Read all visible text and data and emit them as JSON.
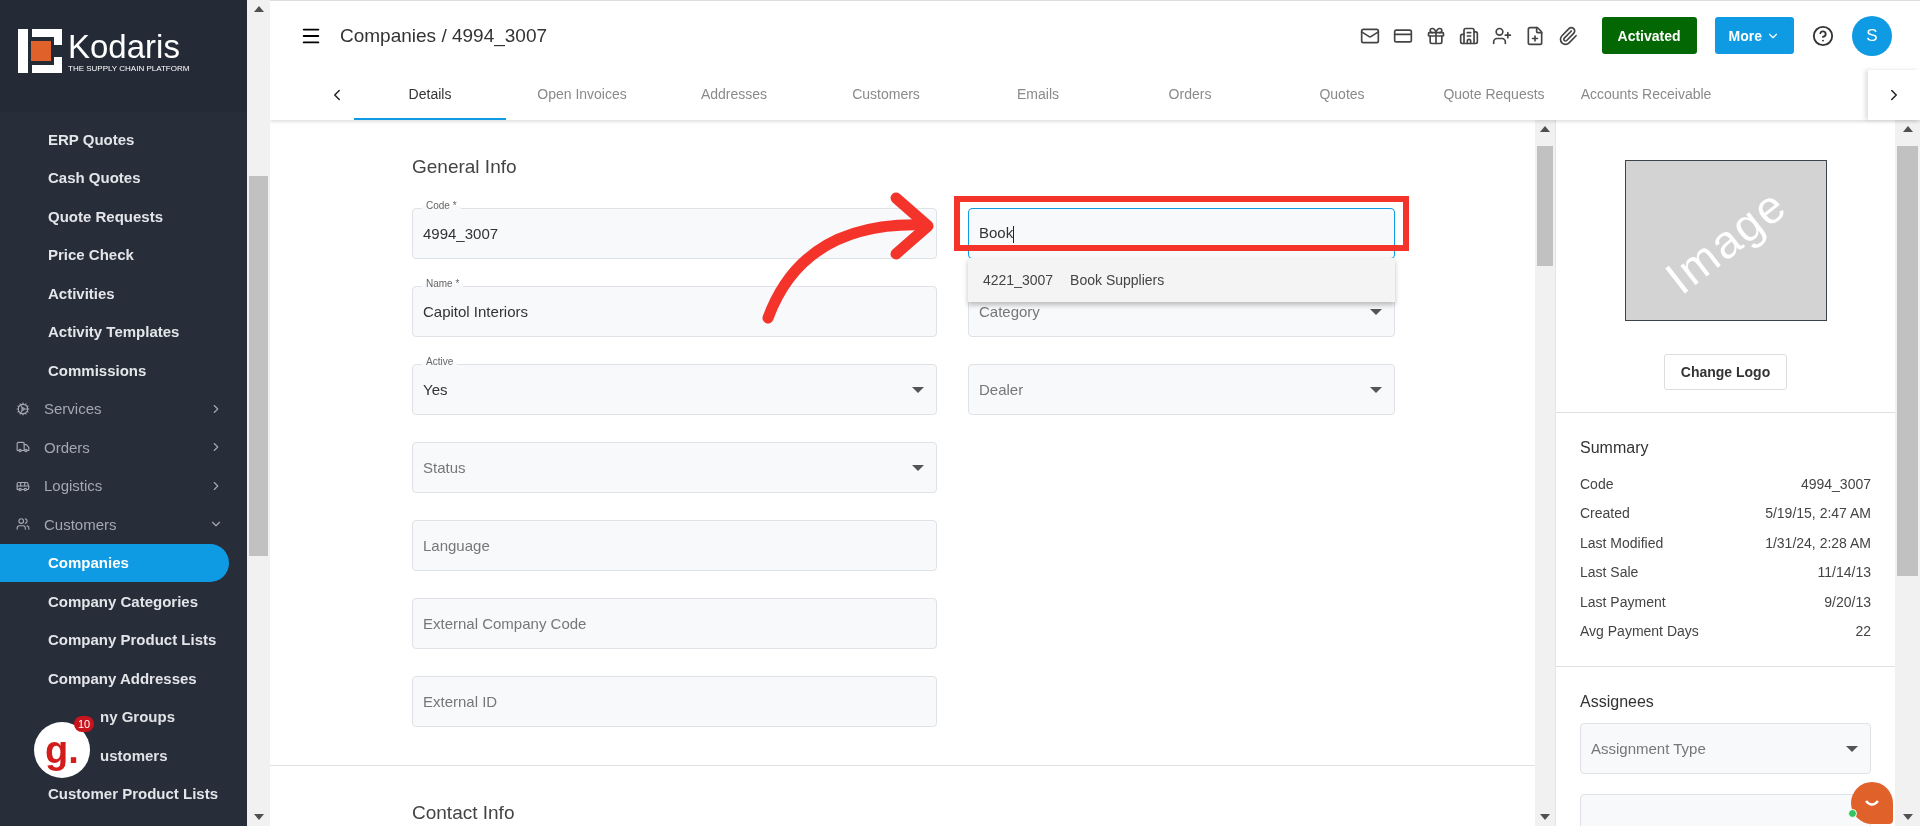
{
  "sidebar": {
    "logo": {
      "name": "Kodaris",
      "tagline": "THE SUPPLY CHAIN PLATFORM"
    },
    "items": [
      {
        "kind": "link",
        "label": "ERP Quotes",
        "selected": false
      },
      {
        "kind": "link",
        "label": "Cash Quotes",
        "selected": false
      },
      {
        "kind": "link",
        "label": "Quote Requests",
        "selected": false
      },
      {
        "kind": "link",
        "label": "Price Check",
        "selected": false
      },
      {
        "kind": "link",
        "label": "Activities",
        "selected": false
      },
      {
        "kind": "link",
        "label": "Activity Templates",
        "selected": false
      },
      {
        "kind": "link",
        "label": "Commissions",
        "selected": false
      },
      {
        "kind": "group",
        "label": "Services",
        "expanded": false
      },
      {
        "kind": "group",
        "label": "Orders",
        "expanded": false
      },
      {
        "kind": "group",
        "label": "Logistics",
        "expanded": false
      },
      {
        "kind": "group",
        "label": "Customers",
        "expanded": true,
        "children": [
          {
            "kind": "link",
            "label": "Companies",
            "selected": true
          },
          {
            "kind": "link",
            "label": "Company Categories",
            "selected": false
          },
          {
            "kind": "link",
            "label": "Company Product Lists",
            "selected": false
          },
          {
            "kind": "link",
            "label": "Company Addresses",
            "selected": false
          },
          {
            "kind": "partial",
            "label": "ny Groups",
            "selected": false
          },
          {
            "kind": "partial",
            "label": "ustomers",
            "selected": false
          },
          {
            "kind": "link",
            "label": "Customer Product Lists",
            "selected": false
          }
        ]
      }
    ],
    "widget": {
      "letter": "g.",
      "badge": "10"
    }
  },
  "header": {
    "title": "Companies / 4994_3007",
    "status_button": "Activated",
    "more_button": "More",
    "avatar": "S"
  },
  "tabs": [
    {
      "label": "Details",
      "selected": true
    },
    {
      "label": "Open Invoices",
      "selected": false
    },
    {
      "label": "Addresses",
      "selected": false
    },
    {
      "label": "Customers",
      "selected": false
    },
    {
      "label": "Emails",
      "selected": false
    },
    {
      "label": "Orders",
      "selected": false
    },
    {
      "label": "Quotes",
      "selected": false
    },
    {
      "label": "Quote Requests",
      "selected": false
    },
    {
      "label": "Accounts Receivable",
      "selected": false
    }
  ],
  "general_info": {
    "title": "General Info",
    "left_fields": [
      {
        "kind": "text",
        "label": "Code *",
        "value": "4994_3007"
      },
      {
        "kind": "text",
        "label": "Name *",
        "value": "Capitol Interiors"
      },
      {
        "kind": "select",
        "label": "Active",
        "value": "Yes"
      },
      {
        "kind": "select",
        "placeholder": "Status"
      },
      {
        "kind": "text",
        "placeholder": "Language"
      },
      {
        "kind": "text",
        "placeholder": "External Company Code"
      },
      {
        "kind": "text",
        "placeholder": "External ID"
      }
    ],
    "search_field": {
      "value": "Book",
      "suggestions": [
        {
          "code": "4221_3007",
          "name": "Book Suppliers"
        }
      ]
    },
    "right_fields": [
      {
        "kind": "select",
        "placeholder": "Category"
      },
      {
        "kind": "select",
        "placeholder": "Dealer"
      }
    ]
  },
  "next_section": {
    "title": "Contact Info"
  },
  "side_panel": {
    "logo_placeholder": "Image",
    "change_logo": "Change Logo",
    "summary": {
      "title": "Summary",
      "rows": [
        {
          "label": "Code",
          "value": "4994_3007"
        },
        {
          "label": "Created",
          "value": "5/19/15, 2:47 AM"
        },
        {
          "label": "Last Modified",
          "value": "1/31/24, 2:28 AM"
        },
        {
          "label": "Last Sale",
          "value": "11/14/13"
        },
        {
          "label": "Last Payment",
          "value": "9/20/13"
        },
        {
          "label": "Avg Payment Days",
          "value": "22"
        }
      ]
    },
    "assignees": {
      "title": "Assignees",
      "fields": [
        {
          "kind": "select",
          "placeholder": "Assignment Type"
        },
        {
          "kind": "text"
        }
      ]
    }
  }
}
